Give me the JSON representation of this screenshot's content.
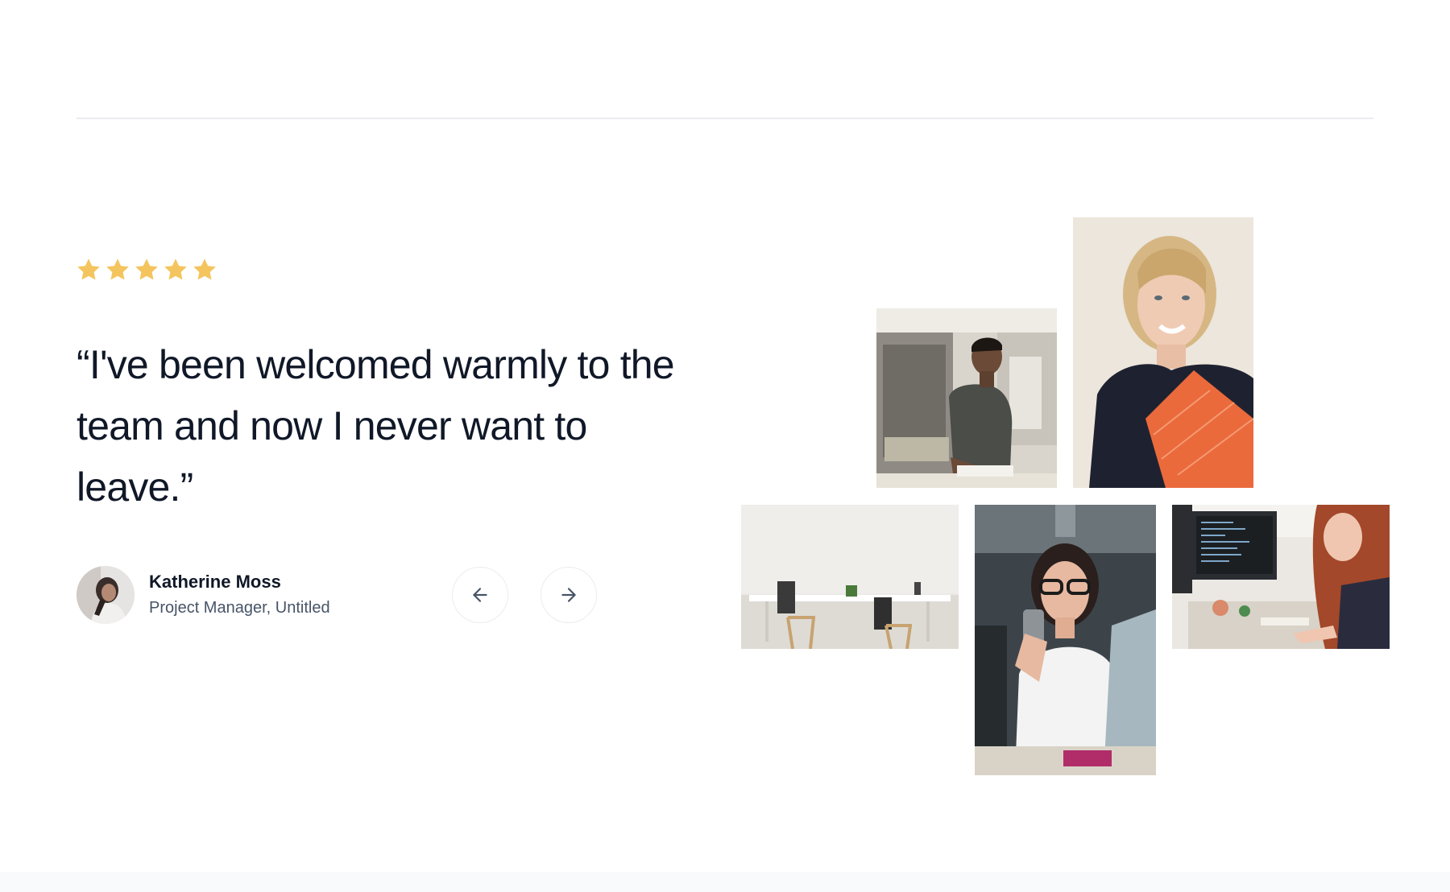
{
  "testimonial": {
    "rating": 5,
    "rating_max": 5,
    "star_color": "#f4c55e",
    "quote": "“I've been welcomed warmly to the team and now I never want to leave.”",
    "author": {
      "name": "Katherine Moss",
      "role": "Project Manager, Untitled"
    }
  },
  "navigation": {
    "prev_icon": "arrow-left-icon",
    "next_icon": "arrow-right-icon"
  },
  "colors": {
    "text_primary": "#101828",
    "text_secondary": "#475467",
    "border": "#eaecf0"
  }
}
